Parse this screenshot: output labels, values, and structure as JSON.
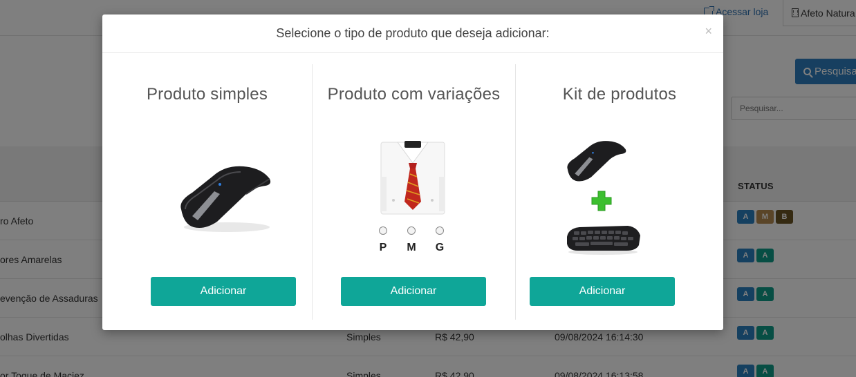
{
  "header": {
    "store_link": "Acessar loja",
    "store_name": "Afeto Natura",
    "search_button": "Pesquisa",
    "search_placeholder": "Pesquisar..."
  },
  "table": {
    "status_header": "STATUS",
    "rows": [
      {
        "name": "ro Afeto",
        "type": "",
        "price": "",
        "date": "",
        "badges": [
          "A",
          "M",
          "B"
        ]
      },
      {
        "name": "ores Amarelas",
        "type": "",
        "price": "",
        "date": "",
        "badges": [
          "A",
          "A"
        ]
      },
      {
        "name": "evenção de Assaduras",
        "type": "",
        "price": "",
        "date": "",
        "badges": [
          "A",
          "A"
        ]
      },
      {
        "name": "olhas Divertidas",
        "type": "Simples",
        "price": "R$ 42,90",
        "date": "09/08/2024 16:14:30",
        "badges": [
          "A",
          "A"
        ]
      },
      {
        "name": "or Toque de Maciez",
        "type": "Simples",
        "price": "R$ 42,90",
        "date": "09/08/2024 16:13:58",
        "badges": [
          "A",
          "A"
        ]
      }
    ]
  },
  "modal": {
    "title": "Selecione o tipo de produto que deseja adicionar:",
    "close": "×",
    "options": [
      {
        "title": "Produto simples",
        "button": "Adicionar"
      },
      {
        "title": "Produto com variações",
        "button": "Adicionar",
        "sizes": [
          "P",
          "M",
          "G"
        ]
      },
      {
        "title": "Kit de produtos",
        "button": "Adicionar"
      }
    ]
  },
  "colors": {
    "primary_button": "#0fa698",
    "search_button": "#2f7fc1",
    "badge_a": "#2a80c1",
    "badge_a_teal": "#0e9c88",
    "badge_m": "#b58a50",
    "badge_b": "#6b5424"
  }
}
